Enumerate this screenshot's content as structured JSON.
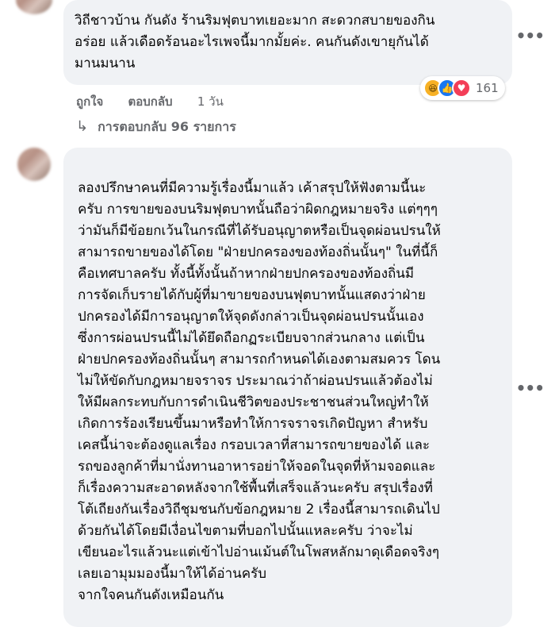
{
  "comment1": {
    "lines": [
      "วิถีชาวบ้าน กันดัง ร้านริมฟุตบาทเยอะมาก สะดวกสบายของกิน",
      "อร่อย แล้วเดือดร้อนอะไรเพจนี้มากมั้ยค่ะ. คนกันดังเขายุกันได้",
      "มานมนาน"
    ],
    "like_label": "ถูกใจ",
    "reply_label": "ตอบกลับ",
    "time": "1 วัน",
    "reaction_icons": [
      "haha-icon",
      "like-icon",
      "love-icon"
    ],
    "reaction_count": "161",
    "replies_label": "การตอบกลับ 96 รายการ"
  },
  "comment2": {
    "lines": [
      "ลองปรึกษาคนที่มีความรู้เรื่องนี้มาแล้ว เค้าสรุปให้ฟังตามนี้นะ",
      "ครับ การขายของบนริมฟุตบาทนั้นถือว่าผิดกฎหมายจริง แต่ๆๆๆ",
      "ว่ามันก็มีข้อยกเว้นในกรณีที่ได้รับอนุญาตหรือเป็นจุดผ่อนปรนให้",
      "สามารถขายของได้โดย \"ฝ่ายปกครองของท้องถิ่นนั้นๆ\" ในที่นี้ก็",
      "คือเทศบาลครับ ทั้งนี้ทั้งนั้นถ้าหากฝ่ายปกครองของท้องถิ่นมี",
      "การจัดเก็บรายได้กับผู้ที่มาขายของบนฟุตบาทนั้นแสดงว่าฝ่าย",
      "ปกครองได้มีการอนุญาตให้จุดดังกล่าวเป็นจุดผ่อนปรนนั้นเอง",
      "ซึ่งการผ่อนปรนนี้ไม่ได้ยึดถือกฏระเบียบจากส่วนกลาง แต่เป็น",
      "ฝ่ายปกครองท้องถิ่นนั้นๆ สามารถกำหนดได้เองตามสมควร โดน",
      "ไม่ให้ขัดกับกฎหมายจราจร ประมาณว่าถ้าผ่อนปรนแล้วต้องไม่",
      "ให้มีผลกระทบกับการดำเนินชีวิตของประชาชนส่วนใหญ่ทำให้",
      "เกิดการร้องเรียนขึ้นมาหรือทำให้การจราจรเกิดปัญหา สำหรับ",
      "เคสนี้น่าจะต้องดูแลเรื่อง กรอบเวลาที่สามารถขายของได้ และ",
      "รถของลูกค้าที่มานั่งทานอาหารอย่าให้จอดในจุดที่ห้ามจอดและ",
      "ก็เรื่องความสะอาดหลังจากใช้พื้นที่เสร็จแล้วนะครับ สรุปเรื่องที่",
      "โต้เถียงกันเรื่องวิถีชุมชนกับข้อกฎหมาย 2 เรื่องนี้สามารถเดินไป",
      "ด้วยกันได้โดยมีเงื่อนไขตามที่บอกไปนั้นแหละครับ ว่าจะไม่",
      "เขียนอะไรแล้วนะแต่เข้าไปอ่านเม้นต์ในโพสหลักมาดุเดือดจริงๆ",
      "เลยเอามุมมองนี้มาให้ได้อ่านครับ",
      "จากใจคนกันดังเหมือนกัน"
    ]
  }
}
